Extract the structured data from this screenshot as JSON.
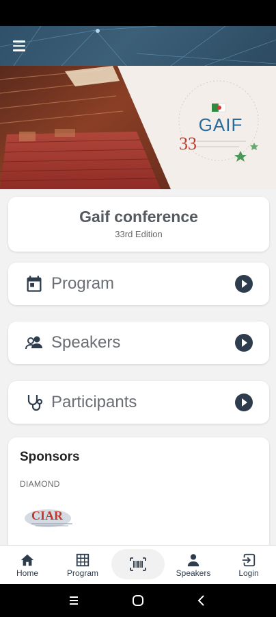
{
  "app": {
    "menu_icon": "menu-icon"
  },
  "hero": {
    "logo_text": "GAIF",
    "edition_mark": "33"
  },
  "conference": {
    "title": "Gaif conference",
    "subtitle": "33rd Edition"
  },
  "menu": [
    {
      "label": "Program",
      "icon": "calendar-icon"
    },
    {
      "label": "Speakers",
      "icon": "people-icon"
    },
    {
      "label": "Participants",
      "icon": "stethoscope-icon"
    }
  ],
  "sponsors": {
    "heading": "Sponsors",
    "tier": "DIAMOND",
    "sponsor_logo": "CIAR"
  },
  "bottom_nav": {
    "tabs": [
      {
        "label": "Home",
        "icon": "home-icon"
      },
      {
        "label": "Program",
        "icon": "grid-icon"
      },
      {
        "label": "Speakers",
        "icon": "person-icon"
      },
      {
        "label": "Login",
        "icon": "login-icon"
      }
    ],
    "center_icon": "barcode-scan-icon"
  },
  "colors": {
    "app_bar": "#2f5068",
    "accent": "#2e3d4d",
    "label_gray": "#6a6e74",
    "background": "#f2f2f2"
  }
}
